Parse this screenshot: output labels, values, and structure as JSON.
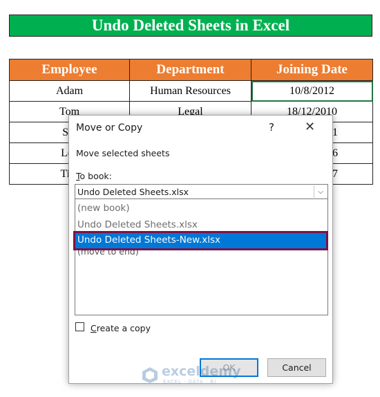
{
  "banner": {
    "title": "Undo Deleted Sheets in Excel"
  },
  "sheet": {
    "headers": [
      "Employee",
      "Department",
      "Joining Date"
    ],
    "rows": [
      [
        "Adam",
        "Human Resources",
        "10/8/2012"
      ],
      [
        "Tom",
        "Legal",
        "18/12/2010"
      ],
      [
        "Ste",
        "",
        "1"
      ],
      [
        "Leo",
        "",
        "6"
      ],
      [
        "Tim",
        "",
        "7"
      ]
    ]
  },
  "dialog": {
    "title": "Move or Copy",
    "help": "?",
    "close": "✕",
    "move_label": "Move selected sheets",
    "to_book_accel": "T",
    "to_book_rest": "o book:",
    "combo_value": "Undo Deleted Sheets.xlsx",
    "combo_arrow": "⌵",
    "options": [
      "(new book)",
      "Undo Deleted Sheets.xlsx",
      "Undo Deleted Sheets-New.xlsx",
      "(move to end)"
    ],
    "create_copy_accel": "C",
    "create_copy_rest": "reate a copy",
    "ok": "OK",
    "cancel": "Cancel"
  },
  "watermark": {
    "name": "exceldemy",
    "tagline": "EXCEL · DATA · BI"
  },
  "colors": {
    "banner": "#00b050",
    "header": "#ed7d31",
    "selection": "#0078d7",
    "highlight_outline": "#7b1348"
  }
}
